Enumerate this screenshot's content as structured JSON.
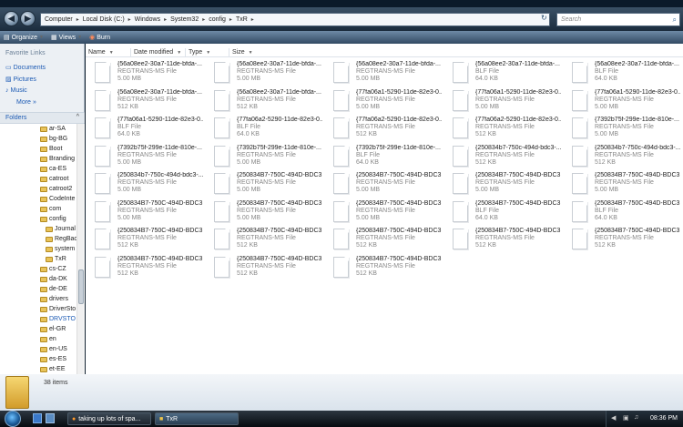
{
  "address": {
    "crumbs": [
      "Computer",
      "Local Disk (C:)",
      "Windows",
      "System32",
      "config",
      "TxR"
    ],
    "search_placeholder": "Search"
  },
  "toolbar": {
    "organize": "Organize",
    "views": "Views",
    "burn": "Burn"
  },
  "favorites": {
    "header": "Favorite Links",
    "items": [
      "Documents",
      "Pictures",
      "Music",
      "More"
    ]
  },
  "folders_label": "Folders",
  "tree": [
    "ar-SA",
    "bg-BG",
    "Boot",
    "Branding",
    "ca-ES",
    "catroot",
    "catroot2",
    "CodeInte",
    "com",
    "config",
    "Journal",
    "RegBac",
    "system",
    "TxR",
    "cs-CZ",
    "da-DK",
    "de-DE",
    "drivers",
    "DriverSto",
    "DRVSTO",
    "el-GR",
    "en",
    "en-US",
    "es-ES",
    "et-EE"
  ],
  "columns": [
    "Name",
    "Date modified",
    "Type",
    "Size"
  ],
  "files": [
    {
      "name": "{56a08ee2-30a7-11de-bfda-...",
      "type": "REGTRANS-MS File",
      "size": "5.00 MB"
    },
    {
      "name": "{56a08ee2-30a7-11de-bfda-...",
      "type": "REGTRANS-MS File",
      "size": "5.00 MB"
    },
    {
      "name": "{56a08ee2-30a7-11de-bfda-...",
      "type": "REGTRANS-MS File",
      "size": "5.00 MB"
    },
    {
      "name": "{56a08ee2-30a7-11de-bfda-...",
      "type": "BLF File",
      "size": "64.0 KB"
    },
    {
      "name": "{56a08ee2-30a7-11de-bfda-...",
      "type": "BLF File",
      "size": "64.0 KB"
    },
    {
      "name": "{56a08ee2-30a7-11de-bfda-...",
      "type": "REGTRANS-MS File",
      "size": "512 KB"
    },
    {
      "name": "{56a08ee2-30a7-11de-bfda-...",
      "type": "REGTRANS-MS File",
      "size": "512 KB"
    },
    {
      "name": "{77fa06a1-5290-11de-82e3-0...",
      "type": "REGTRANS-MS File",
      "size": "5.00 MB"
    },
    {
      "name": "{77fa06a1-5290-11de-82e3-0...",
      "type": "REGTRANS-MS File",
      "size": "5.00 MB"
    },
    {
      "name": "{77fa06a1-5290-11de-82e3-0...",
      "type": "REGTRANS-MS File",
      "size": "5.00 MB"
    },
    {
      "name": "{77fa06a1-5290-11de-82e3-0...",
      "type": "BLF File",
      "size": "64.0 KB"
    },
    {
      "name": "{77fa06a2-5290-11de-82e3-0...",
      "type": "BLF File",
      "size": "64.0 KB"
    },
    {
      "name": "{77fa06a2-5290-11de-82e3-0...",
      "type": "REGTRANS-MS File",
      "size": "512 KB"
    },
    {
      "name": "{77fa06a2-5290-11de-82e3-0...",
      "type": "REGTRANS-MS File",
      "size": "512 KB"
    },
    {
      "name": "{7392b75f-299e-11de-810e-...",
      "type": "REGTRANS-MS File",
      "size": "5.00 MB"
    },
    {
      "name": "{7392b75f-299e-11de-810e-...",
      "type": "REGTRANS-MS File",
      "size": "5.00 MB"
    },
    {
      "name": "{7392b75f-299e-11de-810e-...",
      "type": "REGTRANS-MS File",
      "size": "5.00 MB"
    },
    {
      "name": "{7392b75f-299e-11de-810e-...",
      "type": "BLF File",
      "size": "64.0 KB"
    },
    {
      "name": "{250834b7-750c-494d-bdc3-...",
      "type": "REGTRANS-MS File",
      "size": "512 KB"
    },
    {
      "name": "{250834b7-750c-494d-bdc3-...",
      "type": "REGTRANS-MS File",
      "size": "512 KB"
    },
    {
      "name": "{250834b7-750c-494d-bdc3-...",
      "type": "REGTRANS-MS File",
      "size": "5.00 MB"
    },
    {
      "name": "{250834B7-750C-494D-BDC3...",
      "type": "REGTRANS-MS File",
      "size": "5.00 MB"
    },
    {
      "name": "{250834B7-750C-494D-BDC3...",
      "type": "REGTRANS-MS File",
      "size": "5.00 MB"
    },
    {
      "name": "{250834B7-750C-494D-BDC3...",
      "type": "REGTRANS-MS File",
      "size": "5.00 MB"
    },
    {
      "name": "{250834B7-750C-494D-BDC3...",
      "type": "REGTRANS-MS File",
      "size": "5.00 MB"
    },
    {
      "name": "{250834B7-750C-494D-BDC3...",
      "type": "REGTRANS-MS File",
      "size": "5.00 MB"
    },
    {
      "name": "{250834B7-750C-494D-BDC3...",
      "type": "REGTRANS-MS File",
      "size": "5.00 MB"
    },
    {
      "name": "{250834B7-750C-494D-BDC3...",
      "type": "REGTRANS-MS File",
      "size": "5.00 MB"
    },
    {
      "name": "{250834B7-750C-494D-BDC3...",
      "type": "BLF File",
      "size": "64.0 KB"
    },
    {
      "name": "{250834B7-750C-494D-BDC3...",
      "type": "BLF File",
      "size": "64.0 KB"
    },
    {
      "name": "{250834B7-750C-494D-BDC3...",
      "type": "REGTRANS-MS File",
      "size": "512 KB"
    },
    {
      "name": "{250834B7-750C-494D-BDC3...",
      "type": "REGTRANS-MS File",
      "size": "512 KB"
    },
    {
      "name": "{250834B7-750C-494D-BDC3...",
      "type": "REGTRANS-MS File",
      "size": "512 KB"
    },
    {
      "name": "{250834B7-750C-494D-BDC3...",
      "type": "REGTRANS-MS File",
      "size": "512 KB"
    },
    {
      "name": "{250834B7-750C-494D-BDC3...",
      "type": "REGTRANS-MS File",
      "size": "512 KB"
    },
    {
      "name": "{250834B7-750C-494D-BDC3...",
      "type": "REGTRANS-MS File",
      "size": "512 KB"
    },
    {
      "name": "{250834B7-750C-494D-BDC3...",
      "type": "REGTRANS-MS File",
      "size": "512 KB"
    },
    {
      "name": "{250834B7-750C-494D-BDC3...",
      "type": "REGTRANS-MS File",
      "size": "512 KB"
    }
  ],
  "status": {
    "count": "38 items"
  },
  "taskbar": {
    "tasks": [
      "taking up lots of spa...",
      "TxR"
    ],
    "clock": "08:36 PM"
  },
  "colors": {
    "accent": "#1d5bb4",
    "folder": "#e8c35a"
  },
  "icons": {
    "start": "windows-orb-icon",
    "firefox": "firefox-icon",
    "folder": "folder-icon"
  }
}
